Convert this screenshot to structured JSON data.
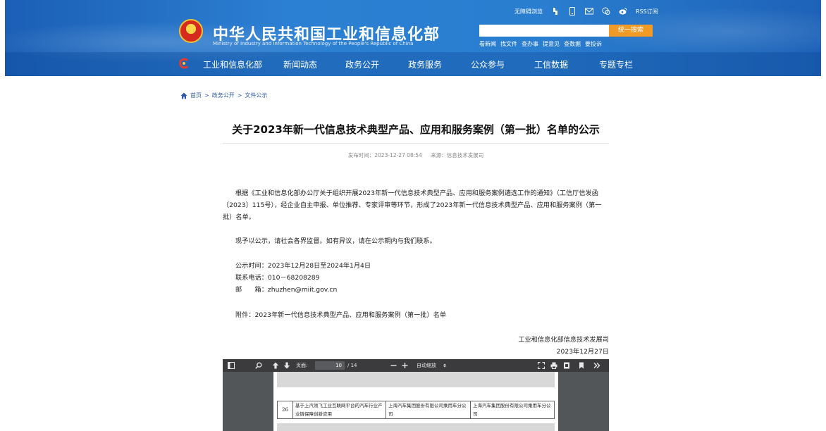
{
  "header": {
    "site_title": "中华人民共和国工业和信息化部",
    "site_subtitle": "Ministry of Industry and Information Technology of the People's Republic of China",
    "accessibility_label": "无障碍浏览",
    "rss_label": "RSS订阅",
    "search": {
      "placeholder": "",
      "button_label": "统一搜索"
    },
    "quick_links": [
      "看新闻",
      "找文件",
      "查办事",
      "提意见",
      "查数据",
      "要投诉"
    ],
    "nav": [
      "工业和信息化部",
      "新闻动态",
      "政务公开",
      "政务服务",
      "公众参与",
      "工信数据",
      "专题专栏"
    ],
    "colors": {
      "header_blue": "#2a7ed0",
      "search_button": "#f19a25"
    }
  },
  "breadcrumb": {
    "home": "首页",
    "separator": ">",
    "level1": "政务公开",
    "level2": "文件公示"
  },
  "article": {
    "title": "关于2023年新一代信息技术典型产品、应用和服务案例（第一批）名单的公示",
    "publish_time": "发布时间：2023-12-27 08:54",
    "source": "来源：信息技术发展司",
    "paragraph1": "根据《工业和信息化部办公厅关于组织开展2023年新一代信息技术典型产品、应用和服务案例遴选工作的通知》（工信厅信发函〔2023〕115号），经企业自主申报、单位推荐、专家评审等环节，形成了2023年新一代信息技术典型产品、应用和服务案例（第一批）名单。",
    "paragraph2": "现予以公示，请社会各界监督。如有异议，请在公示期内与我们联系。",
    "period": "公示时间：2023年12月28日至2024年1月4日",
    "phone": "联系电话：010－68208289",
    "email": "邮　　箱：zhuzhen@miit.gov.cn",
    "attachment": "附件：2023年新一代信息技术典型产品、应用和服务案例（第一批）名单",
    "signature_org": "工业和信息化部信息技术发展司",
    "signature_date": "2023年12月27日"
  },
  "pdf_viewer": {
    "page_label": "页面:",
    "page_current": "10",
    "page_total": "/ 14",
    "zoom_label": "自动缩放",
    "table_row": {
      "num": "26",
      "case_name": "基于上汽领飞工业互联网平台的汽车行业产业链保障创新应用",
      "applicant": "上海汽车集团股份有限公司乘用车分公司",
      "recommender": "上海汽车集团股份有限公司乘用车分公司"
    }
  }
}
